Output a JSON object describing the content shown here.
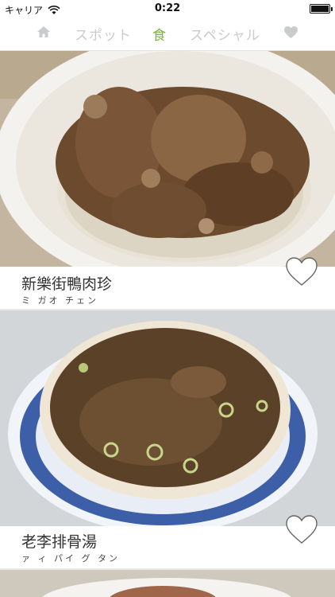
{
  "status_bar": {
    "carrier": "キャリア",
    "time": "0:22"
  },
  "nav": {
    "home_icon": "home-icon",
    "spot_label": "スポット",
    "food_label": "食",
    "special_label": "スペシャル",
    "favorites_icon": "heart-icon",
    "active_color": "#7fb03f",
    "inactive_color": "#c9cbcd"
  },
  "cards": [
    {
      "title": "新樂街鴨肉珍",
      "kana": "ミ ガオ チェン"
    },
    {
      "title": "老李排骨湯",
      "kana": "ァ ィ パイ グ タン"
    }
  ]
}
